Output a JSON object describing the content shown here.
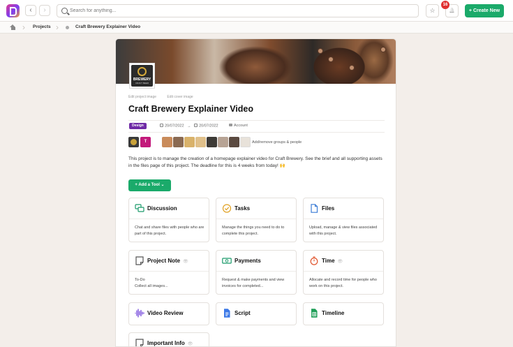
{
  "topbar": {
    "back_glyph": "‹",
    "forward_glyph": "›",
    "search_placeholder": "Search for anything...",
    "star_glyph": "☆",
    "bell_glyph": "🔔",
    "notification_count": "16",
    "create_label": "+ Create New",
    "accent_color": "#1aaa6a"
  },
  "breadcrumb": {
    "projects": "Projects",
    "current": "Craft Brewery Explainer Video"
  },
  "project": {
    "logo_brand": "BREWERY",
    "logo_sub": "CRAFT BEER",
    "edit_project_image": "Edit project image",
    "edit_cover_image": "Edit cover image",
    "title": "Craft Brewery Explainer Video",
    "tag": "Design",
    "start_date": "20/07/2022",
    "arrow": "→",
    "end_date": "20/07/2022",
    "visibility": "Account",
    "team_initial": "T",
    "add_remove_people": "Add/remove groups & people",
    "description": "This project is to manage the creation of a homepage explainer video for Craft Brewery. See the brief and all supporting assets in the files page of this project. The deadline for this is 4 weeks from today! 🙌",
    "add_tool_label": "+ Add a Tool ⌄"
  },
  "tools": [
    {
      "name": "Discussion",
      "desc": "Chat and share files with people who are part of this project.",
      "icon": "chat-bubbles-icon"
    },
    {
      "name": "Tasks",
      "desc": "Manage the things you need to do to complete this project.",
      "icon": "check-circle-icon"
    },
    {
      "name": "Files",
      "desc": "Upload, manage & view files associated with this project.",
      "icon": "file-icon"
    },
    {
      "name": "Project Note",
      "desc_line1": "To-Do",
      "desc_line2": "Collect all images...",
      "icon": "note-icon",
      "eye": "👁"
    },
    {
      "name": "Payments",
      "desc": "Request & make payments and view invoices for completed...",
      "icon": "banknote-icon"
    },
    {
      "name": "Time",
      "desc": "Allocate and record time for people who work on this project.",
      "icon": "stopwatch-icon",
      "eye": "👁"
    },
    {
      "name": "Video Review",
      "icon": "audio-wave-icon"
    },
    {
      "name": "Script",
      "icon": "google-docs-icon"
    },
    {
      "name": "Timeline",
      "icon": "google-sheets-icon"
    },
    {
      "name": "Important Info",
      "icon": "note-icon",
      "eye": "👁"
    }
  ]
}
